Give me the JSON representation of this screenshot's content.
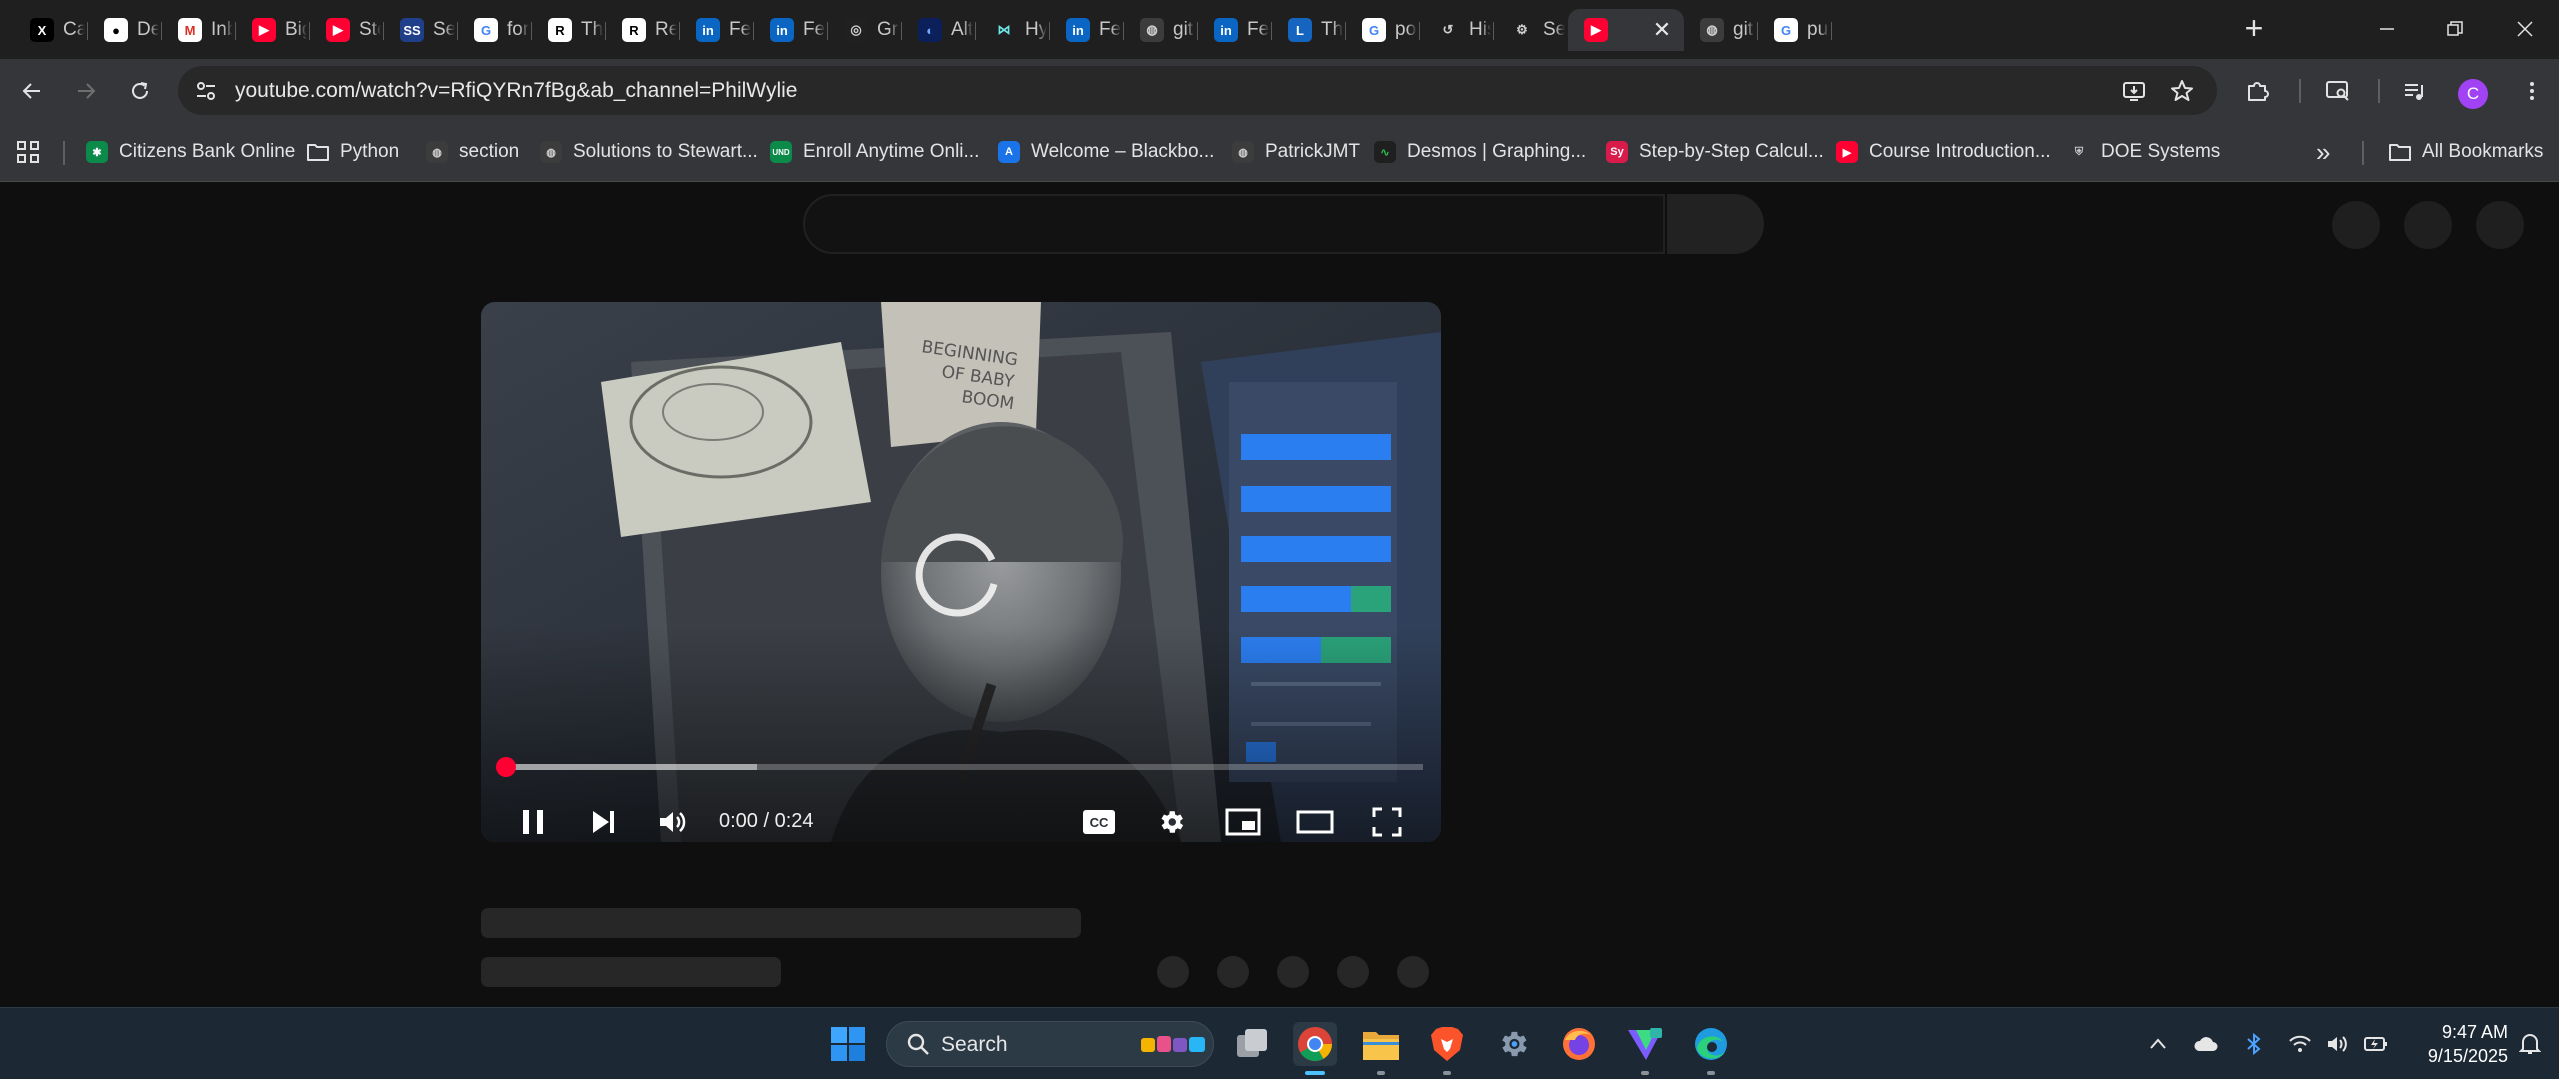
{
  "tabs": [
    {
      "title": "Cal",
      "icon": "x-twitter-icon",
      "bg": "#000000",
      "glyph": "X",
      "fg": "#ffffff"
    },
    {
      "title": "De",
      "icon": "github-icon",
      "bg": "#ffffff",
      "glyph": "●",
      "fg": "#000000"
    },
    {
      "title": "Inb",
      "icon": "gmail-icon",
      "bg": "#ffffff",
      "glyph": "M",
      "fg": "#d93025"
    },
    {
      "title": "Big",
      "icon": "youtube-icon",
      "bg": "#ff0033",
      "glyph": "▶",
      "fg": "#ffffff"
    },
    {
      "title": "Ste",
      "icon": "youtube-icon",
      "bg": "#ff0033",
      "glyph": "▶",
      "fg": "#ffffff"
    },
    {
      "title": "Sea",
      "icon": "ssrn-icon",
      "bg": "#1f3f8a",
      "glyph": "SS",
      "fg": "#ffffff"
    },
    {
      "title": "for",
      "icon": "google-icon",
      "bg": "#ffffff",
      "glyph": "G",
      "fg": "#4285f4"
    },
    {
      "title": "Thr",
      "icon": "researchgate-icon",
      "bg": "#ffffff",
      "glyph": "R",
      "fg": "#000000"
    },
    {
      "title": "Re",
      "icon": "researchgate-icon",
      "bg": "#ffffff",
      "glyph": "R",
      "fg": "#000000"
    },
    {
      "title": "Fee",
      "icon": "linkedin-icon",
      "bg": "#0a66c2",
      "glyph": "in",
      "fg": "#ffffff"
    },
    {
      "title": "Fee",
      "icon": "linkedin-icon",
      "bg": "#0a66c2",
      "glyph": "in",
      "fg": "#ffffff"
    },
    {
      "title": "Gra",
      "icon": "openai-icon",
      "bg": "#202020",
      "glyph": "◎",
      "fg": "#cfcfcf"
    },
    {
      "title": "Alt",
      "icon": "meta-icon",
      "bg": "#0b1f5a",
      "glyph": "◐",
      "fg": "#6fa8ff"
    },
    {
      "title": "Hy",
      "icon": "hyper-icon",
      "bg": "#1f1f1f",
      "glyph": "⋈",
      "fg": "#6ee7e7"
    },
    {
      "title": "Fee",
      "icon": "linkedin-icon",
      "bg": "#0a66c2",
      "glyph": "in",
      "fg": "#ffffff"
    },
    {
      "title": "git",
      "icon": "globe-icon",
      "bg": "#3c3c3c",
      "glyph": "◍",
      "fg": "#d0d0d0"
    },
    {
      "title": "Fee",
      "icon": "linkedin-icon",
      "bg": "#0a66c2",
      "glyph": "in",
      "fg": "#ffffff"
    },
    {
      "title": "Th",
      "icon": "link-icon",
      "bg": "#1565c0",
      "glyph": "L",
      "fg": "#ffffff"
    },
    {
      "title": "po",
      "icon": "google-icon",
      "bg": "#ffffff",
      "glyph": "G",
      "fg": "#4285f4"
    },
    {
      "title": "His",
      "icon": "history-icon",
      "bg": "#1f1f1f",
      "glyph": "↺",
      "fg": "#d0d0d0"
    },
    {
      "title": "Set",
      "icon": "settings-icon",
      "bg": "#1f1f1f",
      "glyph": "⚙",
      "fg": "#d0d0d0"
    },
    {
      "title": "",
      "icon": "youtube-icon",
      "bg": "#ff0033",
      "glyph": "▶",
      "fg": "#ffffff",
      "active": true
    },
    {
      "title": "git",
      "icon": "globe-icon",
      "bg": "#3c3c3c",
      "glyph": "◍",
      "fg": "#d0d0d0"
    },
    {
      "title": "pu",
      "icon": "google-icon",
      "bg": "#ffffff",
      "glyph": "G",
      "fg": "#4285f4"
    }
  ],
  "tab_close_glyph": "✕",
  "new_tab_glyph": "+",
  "omnibox": {
    "url": "youtube.com/watch?v=RfiQYRn7fBg&ab_channel=PhilWylie"
  },
  "profile": {
    "initial": "C",
    "color": "#a142f4"
  },
  "bookmarks": [
    {
      "label": "Citizens Bank Online",
      "icon": "citizens-bank-icon",
      "bg": "#0b8a4a",
      "glyph": "✱",
      "fg": "#ffffff"
    },
    {
      "label": "Python",
      "icon": "folder-icon",
      "bg": "transparent",
      "glyph": "",
      "fg": "#e3e3e3"
    },
    {
      "label": "section",
      "icon": "globe-icon",
      "bg": "#3c3c3c",
      "glyph": "◍",
      "fg": "#d0d0d0"
    },
    {
      "label": "Solutions to Stewart...",
      "icon": "globe-icon",
      "bg": "#3c3c3c",
      "glyph": "◍",
      "fg": "#d0d0d0"
    },
    {
      "label": "Enroll Anytime Onli...",
      "icon": "und-icon",
      "bg": "#0b8a4a",
      "glyph": "UND",
      "fg": "#ffffff"
    },
    {
      "label": "Welcome – Blackbo...",
      "icon": "blackboard-icon",
      "bg": "#1a73e8",
      "glyph": "A",
      "fg": "#ffffff"
    },
    {
      "label": "PatrickJMT",
      "icon": "globe-icon",
      "bg": "#3c3c3c",
      "glyph": "◍",
      "fg": "#d0d0d0"
    },
    {
      "label": "Desmos | Graphing...",
      "icon": "desmos-icon",
      "bg": "#1f1f1f",
      "glyph": "∿",
      "fg": "#2dbd4e"
    },
    {
      "label": "Step-by-Step Calcul...",
      "icon": "symbolab-icon",
      "bg": "#d81b4a",
      "glyph": "Sy",
      "fg": "#ffffff"
    },
    {
      "label": "Course Introduction...",
      "icon": "youtube-icon",
      "bg": "#ff0033",
      "glyph": "▶",
      "fg": "#ffffff"
    },
    {
      "label": "DOE Systems",
      "icon": "shield-icon",
      "bg": "transparent",
      "glyph": "⛨",
      "fg": "#c8c8c8"
    }
  ],
  "bookmarks_overflow_glyph": "»",
  "all_bookmarks_label": "All Bookmarks",
  "player": {
    "current_time": "0:00",
    "duration": "0:24",
    "played_fraction": 0.0,
    "buffered_fraction": 0.28,
    "progress_color": "#ff0033"
  },
  "taskbar": {
    "search_label": "Search",
    "apps": [
      "windows-start-icon",
      "task-view-icon",
      "chrome-icon",
      "file-explorer-icon",
      "brave-icon",
      "settings-icon",
      "firefox-icon",
      "vpn-icon",
      "edge-icon"
    ],
    "time": "9:47 AM",
    "date": "9/15/2025"
  }
}
